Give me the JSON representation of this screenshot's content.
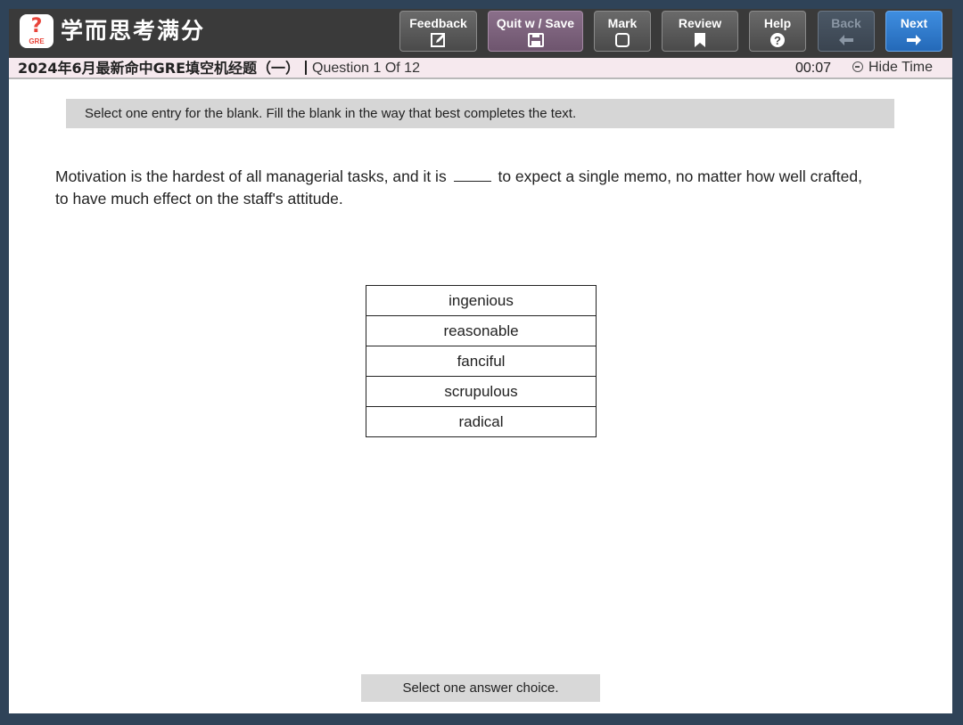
{
  "app": {
    "logo_mark": "?",
    "logo_sub": "GRE",
    "brand_name": "学而思考满分"
  },
  "toolbar": {
    "buttons": [
      {
        "label": "Feedback",
        "icon": "edit-icon"
      },
      {
        "label": "Quit w / Save",
        "icon": "save-icon"
      },
      {
        "label": "Mark",
        "icon": "checkbox-icon"
      },
      {
        "label": "Review",
        "icon": "bookmark-icon"
      },
      {
        "label": "Help",
        "icon": "help-icon"
      },
      {
        "label": "Back",
        "icon": "arrow-left-icon",
        "disabled": true
      },
      {
        "label": "Next",
        "icon": "arrow-right-icon"
      }
    ]
  },
  "status": {
    "exam_title": "2024年6月最新命中GRE填空机经题（一）",
    "question_count": "Question 1 Of 12",
    "timer": "00:07",
    "hide_time_label": "Hide Time"
  },
  "main": {
    "instruction": "Select one entry for the blank. Fill the blank in the way that best completes the text.",
    "question_before": "Motivation is the hardest of all managerial tasks, and it is",
    "question_after": "to expect a single memo, no matter how well crafted, to have much effect on the staff's attitude.",
    "choices": [
      "ingenious",
      "reasonable",
      "fanciful",
      "scrupulous",
      "radical"
    ],
    "footer_note": "Select one answer choice."
  },
  "colors": {
    "toolbar_bg": "#3a3a3a",
    "next_button": "#2f7dd0",
    "quit_button": "#7a607a",
    "status_bg": "#f6e9ee",
    "page_bg": "#2f4358"
  }
}
